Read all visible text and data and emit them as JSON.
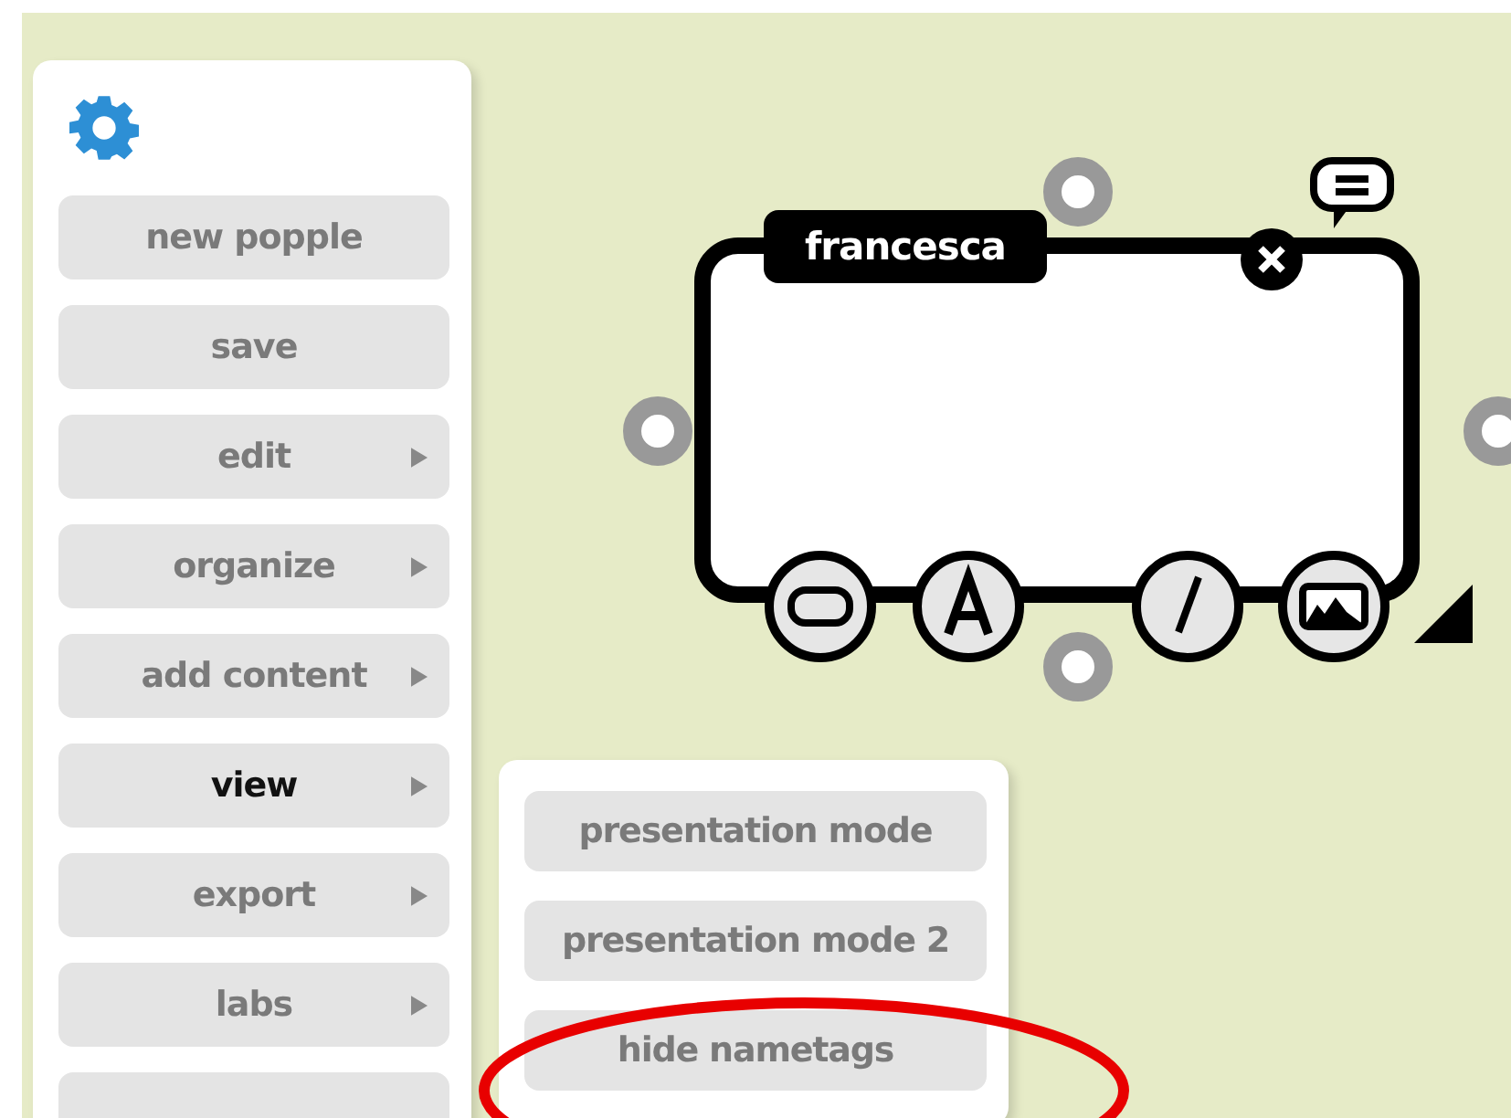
{
  "menu": {
    "items": [
      {
        "label": "new popple",
        "selected": false,
        "has_submenu": false
      },
      {
        "label": "save",
        "selected": false,
        "has_submenu": false
      },
      {
        "label": "edit",
        "selected": false,
        "has_submenu": true
      },
      {
        "label": "organize",
        "selected": false,
        "has_submenu": true
      },
      {
        "label": "add content",
        "selected": false,
        "has_submenu": true
      },
      {
        "label": "view",
        "selected": true,
        "has_submenu": true
      },
      {
        "label": "export",
        "selected": false,
        "has_submenu": true
      },
      {
        "label": "labs",
        "selected": false,
        "has_submenu": true
      }
    ],
    "cut_item": true
  },
  "submenu": {
    "items": [
      {
        "label": "presentation mode"
      },
      {
        "label": "presentation mode 2"
      },
      {
        "label": "hide nametags"
      }
    ]
  },
  "popple": {
    "nametag": "francesca"
  }
}
